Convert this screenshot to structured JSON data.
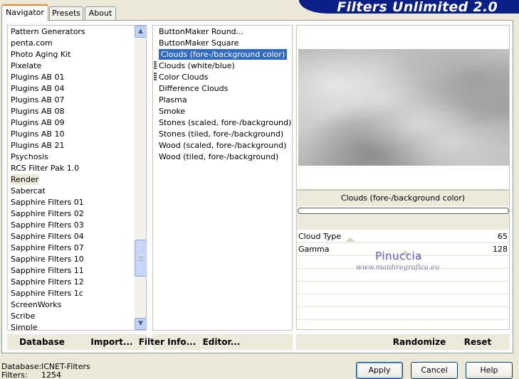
{
  "tabs": [
    {
      "label": "Navigator",
      "active": true
    },
    {
      "label": "Presets",
      "active": false
    },
    {
      "label": "About",
      "active": false
    }
  ],
  "banner_title": "Filters Unlimited 2.0",
  "categories": {
    "items": [
      "Pattern Generators",
      "penta.com",
      "Photo Aging Kit",
      "Pixelate",
      "Plugins AB 01",
      "Plugins AB 04",
      "Plugins AB 07",
      "Plugins AB 08",
      "Plugins AB 09",
      "Plugins AB 10",
      "Plugins AB 21",
      "Psychosis",
      "RCS Filter Pak 1.0",
      "Render",
      "Sabercat",
      "Sapphire Filters 01",
      "Sapphire Filters 02",
      "Sapphire Filters 03",
      "Sapphire Filters 04",
      "Sapphire Filters 07",
      "Sapphire Filters 10",
      "Sapphire Filters 11",
      "Sapphire Filters 12",
      "Sapphire Filters 1c",
      "ScreenWorks",
      "Scribe",
      "Simple"
    ],
    "selected": "Render"
  },
  "filters": {
    "items": [
      "ButtonMaker Round...",
      "ButtonMaker Square",
      "Clouds (fore-/background color)",
      "Clouds (white/blue)",
      "Color Clouds",
      "Difference Clouds",
      "Plasma",
      "Smoke",
      "Stones (scaled, fore-/background)",
      "Stones (tiled, fore-/background)",
      "Wood (scaled, fore-/background)",
      "Wood (tiled, fore-/background)"
    ],
    "selected": "Clouds (fore-/background color)"
  },
  "preview": {
    "filter_name": "Clouds (fore-/background color)"
  },
  "params": [
    {
      "name": "Cloud Type",
      "value": "65"
    },
    {
      "name": "Gamma",
      "value": "128"
    }
  ],
  "watermark": {
    "line1": "Pinuccia",
    "line2": "www.maidiregrafica.eu"
  },
  "panel_buttons": {
    "database": "Database",
    "import": "Import...",
    "filter_info": "Filter Info...",
    "editor": "Editor...",
    "randomize": "Randomize",
    "reset": "Reset"
  },
  "status": {
    "database_label": "Database:",
    "database_value": "ICNET-Filters",
    "filters_label": "Filters:",
    "filters_value": "1254"
  },
  "dialog_buttons": {
    "apply": "Apply",
    "cancel": "Cancel",
    "help": "Help"
  },
  "colors": {
    "selection": "#316ac5",
    "banner": "#0a1f86",
    "window_bg": "#ece9d8"
  }
}
